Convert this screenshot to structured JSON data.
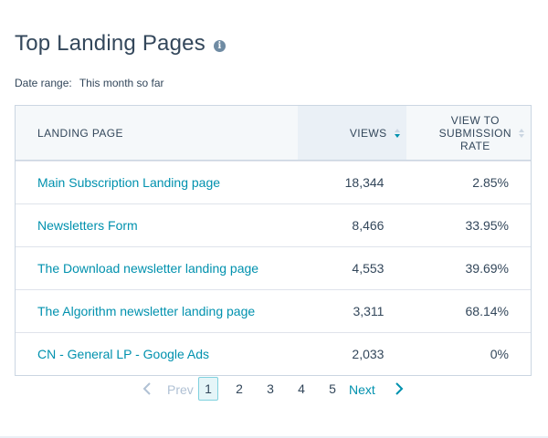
{
  "header": {
    "title": "Top Landing Pages",
    "info_icon": "info-icon",
    "date_range_label": "Date range:",
    "date_range_value": "This month so far"
  },
  "table": {
    "columns": {
      "page": "LANDING PAGE",
      "views": "VIEWS",
      "rate_line1": "VIEW TO",
      "rate_line2": "SUBMISSION",
      "rate_line3": "RATE"
    },
    "sorted_column": "views",
    "sort_direction": "descending",
    "rows": [
      {
        "page": "Main Subscription Landing page",
        "views": "18,344",
        "rate": "2.85%"
      },
      {
        "page": "Newsletters Form",
        "views": "8,466",
        "rate": "33.95%"
      },
      {
        "page": "The Download newsletter landing page",
        "views": "4,553",
        "rate": "39.69%"
      },
      {
        "page": "The Algorithm newsletter landing page",
        "views": "3,311",
        "rate": "68.14%"
      },
      {
        "page": "CN - General LP - Google Ads",
        "views": "2,033",
        "rate": "0%"
      }
    ]
  },
  "pagination": {
    "prev_label": "Prev",
    "next_label": "Next",
    "pages": [
      "1",
      "2",
      "3",
      "4",
      "5"
    ],
    "current_page": "1"
  },
  "colors": {
    "link": "#0091ae",
    "text": "#33475b",
    "border": "#cbd6e2",
    "header_bg": "#f5f8fa"
  }
}
